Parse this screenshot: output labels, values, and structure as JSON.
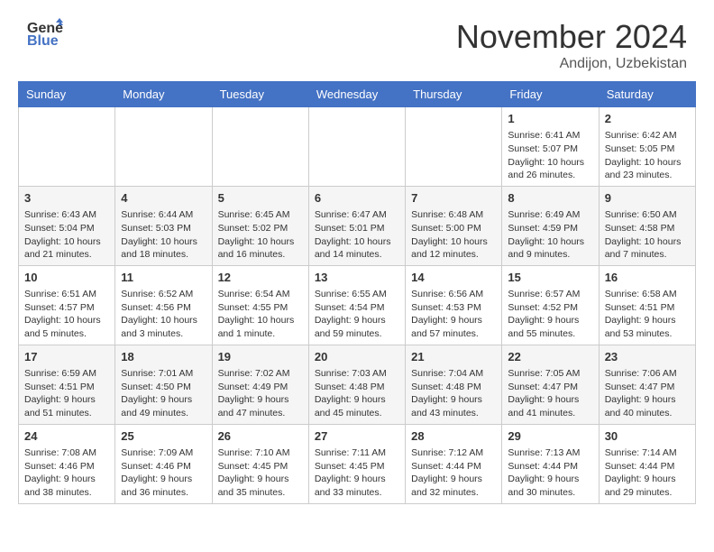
{
  "header": {
    "logo_line1": "General",
    "logo_line2": "Blue",
    "title": "November 2024",
    "location": "Andijon, Uzbekistan"
  },
  "columns": [
    "Sunday",
    "Monday",
    "Tuesday",
    "Wednesday",
    "Thursday",
    "Friday",
    "Saturday"
  ],
  "weeks": [
    [
      {
        "day": "",
        "info": ""
      },
      {
        "day": "",
        "info": ""
      },
      {
        "day": "",
        "info": ""
      },
      {
        "day": "",
        "info": ""
      },
      {
        "day": "",
        "info": ""
      },
      {
        "day": "1",
        "info": "Sunrise: 6:41 AM\nSunset: 5:07 PM\nDaylight: 10 hours and 26 minutes."
      },
      {
        "day": "2",
        "info": "Sunrise: 6:42 AM\nSunset: 5:05 PM\nDaylight: 10 hours and 23 minutes."
      }
    ],
    [
      {
        "day": "3",
        "info": "Sunrise: 6:43 AM\nSunset: 5:04 PM\nDaylight: 10 hours and 21 minutes."
      },
      {
        "day": "4",
        "info": "Sunrise: 6:44 AM\nSunset: 5:03 PM\nDaylight: 10 hours and 18 minutes."
      },
      {
        "day": "5",
        "info": "Sunrise: 6:45 AM\nSunset: 5:02 PM\nDaylight: 10 hours and 16 minutes."
      },
      {
        "day": "6",
        "info": "Sunrise: 6:47 AM\nSunset: 5:01 PM\nDaylight: 10 hours and 14 minutes."
      },
      {
        "day": "7",
        "info": "Sunrise: 6:48 AM\nSunset: 5:00 PM\nDaylight: 10 hours and 12 minutes."
      },
      {
        "day": "8",
        "info": "Sunrise: 6:49 AM\nSunset: 4:59 PM\nDaylight: 10 hours and 9 minutes."
      },
      {
        "day": "9",
        "info": "Sunrise: 6:50 AM\nSunset: 4:58 PM\nDaylight: 10 hours and 7 minutes."
      }
    ],
    [
      {
        "day": "10",
        "info": "Sunrise: 6:51 AM\nSunset: 4:57 PM\nDaylight: 10 hours and 5 minutes."
      },
      {
        "day": "11",
        "info": "Sunrise: 6:52 AM\nSunset: 4:56 PM\nDaylight: 10 hours and 3 minutes."
      },
      {
        "day": "12",
        "info": "Sunrise: 6:54 AM\nSunset: 4:55 PM\nDaylight: 10 hours and 1 minute."
      },
      {
        "day": "13",
        "info": "Sunrise: 6:55 AM\nSunset: 4:54 PM\nDaylight: 9 hours and 59 minutes."
      },
      {
        "day": "14",
        "info": "Sunrise: 6:56 AM\nSunset: 4:53 PM\nDaylight: 9 hours and 57 minutes."
      },
      {
        "day": "15",
        "info": "Sunrise: 6:57 AM\nSunset: 4:52 PM\nDaylight: 9 hours and 55 minutes."
      },
      {
        "day": "16",
        "info": "Sunrise: 6:58 AM\nSunset: 4:51 PM\nDaylight: 9 hours and 53 minutes."
      }
    ],
    [
      {
        "day": "17",
        "info": "Sunrise: 6:59 AM\nSunset: 4:51 PM\nDaylight: 9 hours and 51 minutes."
      },
      {
        "day": "18",
        "info": "Sunrise: 7:01 AM\nSunset: 4:50 PM\nDaylight: 9 hours and 49 minutes."
      },
      {
        "day": "19",
        "info": "Sunrise: 7:02 AM\nSunset: 4:49 PM\nDaylight: 9 hours and 47 minutes."
      },
      {
        "day": "20",
        "info": "Sunrise: 7:03 AM\nSunset: 4:48 PM\nDaylight: 9 hours and 45 minutes."
      },
      {
        "day": "21",
        "info": "Sunrise: 7:04 AM\nSunset: 4:48 PM\nDaylight: 9 hours and 43 minutes."
      },
      {
        "day": "22",
        "info": "Sunrise: 7:05 AM\nSunset: 4:47 PM\nDaylight: 9 hours and 41 minutes."
      },
      {
        "day": "23",
        "info": "Sunrise: 7:06 AM\nSunset: 4:47 PM\nDaylight: 9 hours and 40 minutes."
      }
    ],
    [
      {
        "day": "24",
        "info": "Sunrise: 7:08 AM\nSunset: 4:46 PM\nDaylight: 9 hours and 38 minutes."
      },
      {
        "day": "25",
        "info": "Sunrise: 7:09 AM\nSunset: 4:46 PM\nDaylight: 9 hours and 36 minutes."
      },
      {
        "day": "26",
        "info": "Sunrise: 7:10 AM\nSunset: 4:45 PM\nDaylight: 9 hours and 35 minutes."
      },
      {
        "day": "27",
        "info": "Sunrise: 7:11 AM\nSunset: 4:45 PM\nDaylight: 9 hours and 33 minutes."
      },
      {
        "day": "28",
        "info": "Sunrise: 7:12 AM\nSunset: 4:44 PM\nDaylight: 9 hours and 32 minutes."
      },
      {
        "day": "29",
        "info": "Sunrise: 7:13 AM\nSunset: 4:44 PM\nDaylight: 9 hours and 30 minutes."
      },
      {
        "day": "30",
        "info": "Sunrise: 7:14 AM\nSunset: 4:44 PM\nDaylight: 9 hours and 29 minutes."
      }
    ]
  ]
}
